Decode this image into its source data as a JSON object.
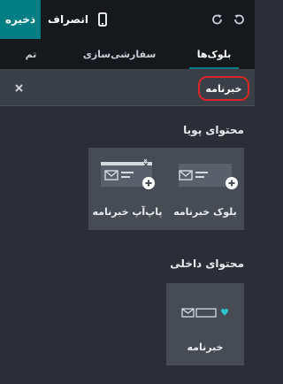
{
  "toolbar": {
    "save_label": "ذخیره",
    "discard_label": "انصراف",
    "mobile_icon": "mobile-icon",
    "redo_icon": "redo-icon",
    "undo_icon": "undo-icon"
  },
  "tabs": [
    {
      "label": "بلوک‌ها",
      "active": true
    },
    {
      "label": "سفارشی‌سازی",
      "active": false
    },
    {
      "label": "تم",
      "active": false
    }
  ],
  "search": {
    "value": "خبرنامه",
    "clear_icon": "close-icon"
  },
  "sections": {
    "dynamic": {
      "title": "محتوای پویا",
      "cards": [
        {
          "label": "بلوک خبرنامه",
          "icon": "newsletter-block-thumbnail"
        },
        {
          "label": "پاپ‌آپ خبرنامه",
          "icon": "newsletter-popup-thumbnail"
        }
      ]
    },
    "inner": {
      "title": "محتوای داخلی",
      "cards": [
        {
          "label": "خبرنامه",
          "icon": "newsletter-inner-thumbnail"
        }
      ]
    }
  },
  "colors": {
    "accent": "#017e84",
    "highlight": "#d9262a",
    "background": "#2b2e36",
    "card": "#464b54"
  }
}
